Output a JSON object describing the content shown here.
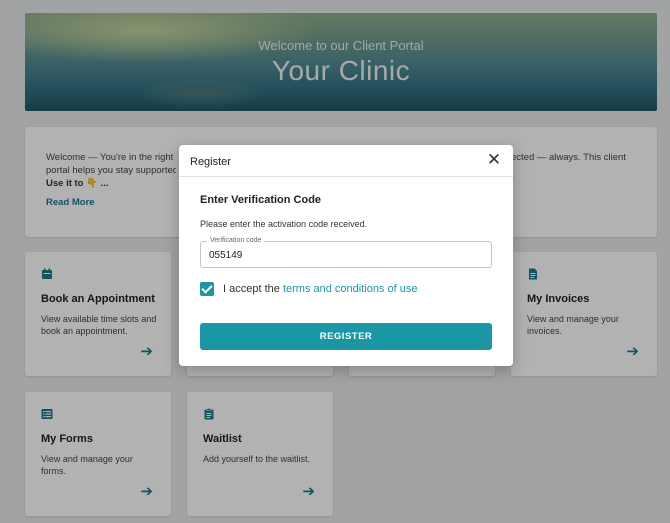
{
  "hero": {
    "subtitle": "Welcome to our Client Portal",
    "title": "Your Clinic"
  },
  "intro": {
    "line1_left": "Welcome — You're in the right pl",
    "line2_left": "portal helps you stay supported",
    "line3_left": "Use it to 👇 ...",
    "line1_right": "ected — always. This client",
    "read_more": "Read More"
  },
  "tiles": [
    {
      "title": "Book an Appointment",
      "desc": "View available time slots and book an appointment.",
      "icon": "calendar-icon"
    },
    {
      "title": "My Invoices",
      "desc": "View and manage your invoices.",
      "icon": "document-icon"
    },
    {
      "title": "My Forms",
      "desc": "View and manage your forms.",
      "icon": "list-icon"
    },
    {
      "title": "Waitlist",
      "desc": "Add yourself to the waitlist.",
      "icon": "clipboard-icon"
    }
  ],
  "dialog": {
    "title": "Register",
    "close_glyph": "✕",
    "heading": "Enter Verification Code",
    "instructions": "Please enter the activation code received.",
    "field_label": "Verification code",
    "field_value": "055149",
    "checkbox_checked": true,
    "accept_prefix": "I accept the ",
    "terms_link": "terms and conditions of use",
    "register_label": "REGISTER"
  },
  "colors": {
    "accent": "#1a96a5",
    "link": "#1a7a8c"
  }
}
